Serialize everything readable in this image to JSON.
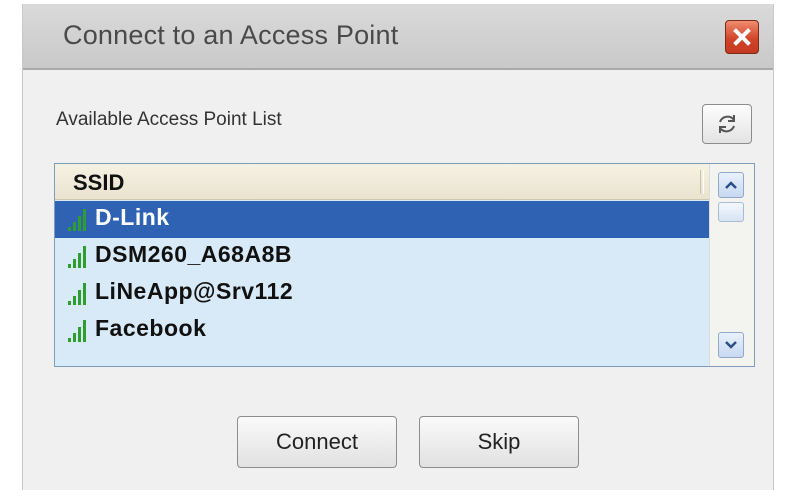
{
  "window": {
    "title": "Connect to an Access Point"
  },
  "list": {
    "label": "Available Access Point List",
    "column_header": "SSID",
    "items": [
      {
        "ssid": "D-Link",
        "selected": true
      },
      {
        "ssid": "DSM260_A68A8B",
        "selected": false
      },
      {
        "ssid": "LiNeApp@Srv112",
        "selected": false
      },
      {
        "ssid": "Facebook",
        "selected": false
      }
    ]
  },
  "buttons": {
    "connect_label": "Connect",
    "skip_label": "Skip"
  },
  "icons": {
    "close": "close-icon",
    "refresh": "refresh-icon",
    "signal": "signal-strength-icon",
    "scroll_up": "chevron-up-icon",
    "scroll_down": "chevron-down-icon"
  },
  "colors": {
    "selection": "#2f62b3",
    "list_background": "#d8eaf7",
    "signal_bars": "#2e9e2e",
    "close_button": "#d1452a"
  }
}
